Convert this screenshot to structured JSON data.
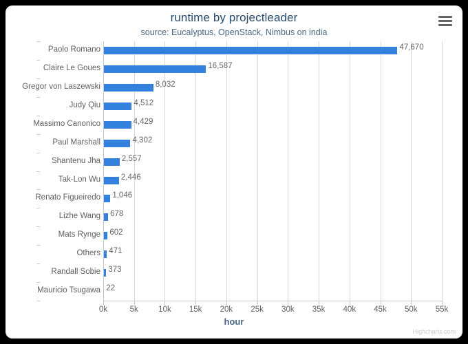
{
  "chart_data": {
    "type": "bar",
    "title": "runtime by projectleader",
    "subtitle": "source: Eucalyptus, OpenStack, Nimbus on india",
    "xlabel": "hour",
    "ylabel": "",
    "orientation": "horizontal",
    "grid": true,
    "legend": false,
    "xlim": [
      0,
      55000
    ],
    "xticks": [
      "0k",
      "5k",
      "10k",
      "15k",
      "20k",
      "25k",
      "30k",
      "35k",
      "40k",
      "45k",
      "50k",
      "55k"
    ],
    "xtick_values": [
      0,
      5000,
      10000,
      15000,
      20000,
      25000,
      30000,
      35000,
      40000,
      45000,
      50000,
      55000
    ],
    "categories": [
      "Paolo Romano",
      "Claire Le Goues",
      "Gregor von Laszewski",
      "Judy Qiu",
      "Massimo Canonico",
      "Paul Marshall",
      "Shantenu Jha",
      "Tak-Lon Wu",
      "Renato Figueiredo",
      "Lizhe Wang",
      "Mats Rynge",
      "Others",
      "Randall Sobie",
      "Mauricio Tsugawa"
    ],
    "values": [
      47670,
      16587,
      8032,
      4512,
      4429,
      4302,
      2557,
      2446,
      1046,
      678,
      602,
      471,
      373,
      22
    ],
    "data_labels": [
      "47,670",
      "16,587",
      "8,032",
      "4,512",
      "4,429",
      "4,302",
      "2,557",
      "2,446",
      "1,046",
      "678",
      "602",
      "471",
      "373",
      "22"
    ],
    "bar_color": "#3380dd"
  },
  "toolbar": {
    "context_menu_label": "menu"
  },
  "credits": {
    "text": "Highcharts.com"
  }
}
